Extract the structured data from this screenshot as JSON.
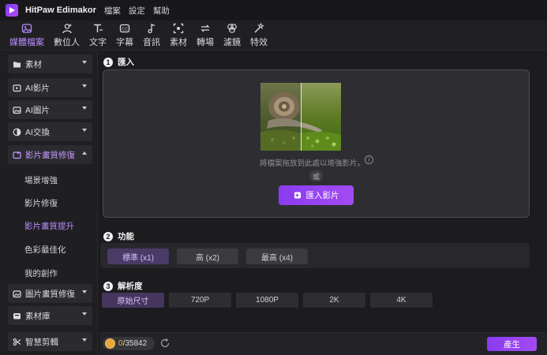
{
  "app": {
    "name": "HitPaw Edimakor",
    "menu": [
      "檔案",
      "設定",
      "幫助"
    ]
  },
  "toolbar": {
    "items": [
      {
        "label": "媒體檔案",
        "icon": "media-icon",
        "active": true
      },
      {
        "label": "數位人",
        "icon": "avatar-icon"
      },
      {
        "label": "文字",
        "icon": "text-icon"
      },
      {
        "label": "字幕",
        "icon": "subtitle-icon"
      },
      {
        "label": "音訊",
        "icon": "music-icon"
      },
      {
        "label": "素材",
        "icon": "assets-icon"
      },
      {
        "label": "轉場",
        "icon": "transition-icon"
      },
      {
        "label": "濾鏡",
        "icon": "filter-icon"
      },
      {
        "label": "特效",
        "icon": "effects-icon"
      }
    ]
  },
  "sidebar": {
    "items": [
      {
        "label": "素材",
        "icon": "folder-icon"
      },
      {
        "label": "AI影片",
        "icon": "ai-video-icon"
      },
      {
        "label": "AI圖片",
        "icon": "ai-image-icon"
      },
      {
        "label": "AI交換",
        "icon": "ai-swap-icon"
      },
      {
        "label": "影片畫質修復",
        "icon": "video-repair-icon",
        "expanded": true
      },
      {
        "label": "圖片畫質修復",
        "icon": "image-repair-icon"
      },
      {
        "label": "素材庫",
        "icon": "library-icon"
      },
      {
        "label": "智慧剪輯",
        "icon": "scissors-icon"
      }
    ],
    "subitems": [
      {
        "label": "場景增強"
      },
      {
        "label": "影片修復"
      },
      {
        "label": "影片畫質提升",
        "selected": true
      },
      {
        "label": "色彩最佳化"
      },
      {
        "label": "我的創作"
      }
    ]
  },
  "main": {
    "step1": {
      "num": "1",
      "title": "匯入"
    },
    "hint": "將檔案拖放到此處以增強影片。",
    "or": "或",
    "import_button": "匯入影片",
    "step2": {
      "num": "2",
      "title": "功能"
    },
    "functions": [
      {
        "label": "標準 (x1)",
        "selected": true
      },
      {
        "label": "高 (x2)"
      },
      {
        "label": "最高 (x4)"
      }
    ],
    "step3": {
      "num": "3",
      "title": "解析度"
    },
    "resolutions": [
      {
        "label": "原始尺寸",
        "selected": true
      },
      {
        "label": "720P"
      },
      {
        "label": "1080P"
      },
      {
        "label": "2K"
      },
      {
        "label": "4K"
      }
    ]
  },
  "bottom": {
    "credits_used": "0",
    "credits_total": "/35842",
    "generate": "產生"
  },
  "colors": {
    "accent": "#9a45f2",
    "selected_text": "#b98cff"
  }
}
